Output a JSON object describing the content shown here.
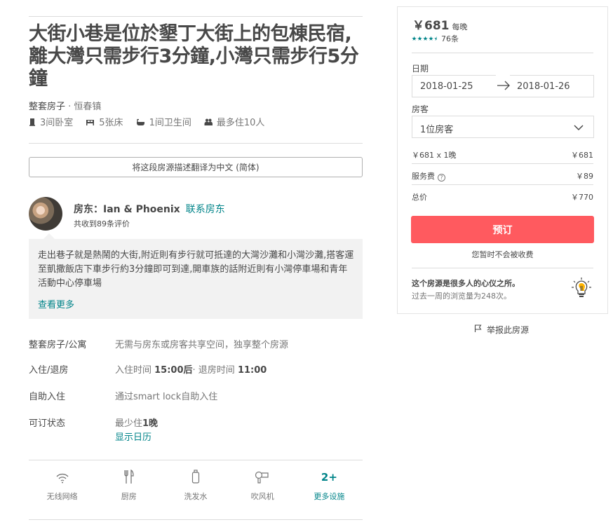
{
  "listing": {
    "title": "大街小巷是位於墾丁大街上的包棟民宿,離大灣只需步行3分鐘,小灣只需步行5分鐘",
    "type": "整套房子",
    "separator": " · ",
    "location": "恒春镇",
    "specs": [
      {
        "icon": "bedroom-icon",
        "label": "3间卧室"
      },
      {
        "icon": "bed-icon",
        "label": "5张床"
      },
      {
        "icon": "bathroom-icon",
        "label": "1间卫生间"
      },
      {
        "icon": "guests-icon",
        "label": "最多住10人"
      }
    ],
    "translate_label": "将这段房源描述翻译为中文 (简体)"
  },
  "host": {
    "prefix": "房东：",
    "name": "Ian & Phoenix",
    "contact_label": "联系房东",
    "reviews": "共收到89条评价"
  },
  "description": {
    "text": "走出巷子就是熱鬧的大街,附近則有步行就可抵達的大灣沙灘和小灣沙灘,搭客運至凱撒飯店下車步行約3分鐘即可到達,開車族的話附近則有小灣停車場和青年活動中心停車場",
    "read_more": "查看更多"
  },
  "details": {
    "space": {
      "label": "整套房子/公寓",
      "value": "无需与房东或房客共享空间，独享整个房源"
    },
    "checkin": {
      "label": "入住/退房",
      "in_prefix": "入住时间 ",
      "in_time": "15:00后",
      "out_prefix": "· 退房时间 ",
      "out_time": "11:00"
    },
    "self_checkin": {
      "label": "自助入住",
      "value": "通过smart lock自助入住"
    },
    "availability": {
      "label": "可订状态",
      "min_prefix": "最少住",
      "min_value": "1晚",
      "calendar_link": "显示日历"
    }
  },
  "amenities": [
    {
      "icon": "wifi-icon",
      "label": "无线网络"
    },
    {
      "icon": "kitchen-icon",
      "label": "厨房"
    },
    {
      "icon": "shampoo-icon",
      "label": "洗发水"
    },
    {
      "icon": "hairdryer-icon",
      "label": "吹风机"
    }
  ],
  "amenities_more": {
    "count": "2+",
    "label": "更多设施"
  },
  "booking": {
    "price": "￥681",
    "per_night": "每晚",
    "rating": 4.5,
    "review_count": "76条",
    "date_label": "日期",
    "checkin_date": "2018-01-25",
    "checkout_date": "2018-01-26",
    "guests_label": "房客",
    "guests_value": "1位房客",
    "line_nights_label": "￥681 x 1晚",
    "line_nights_value": "￥681",
    "service_fee_label": "服务费",
    "service_fee_value": "￥89",
    "total_label": "总价",
    "total_value": "￥770",
    "book_label": "预订",
    "no_charge": "您暂时不会被收费",
    "popular_title": "这个房源是很多人的心仪之所。",
    "popular_sub": "过去一周的浏览量为248次。"
  },
  "report_label": "举报此房源",
  "colors": {
    "accent": "#008489",
    "book": "#ff5a5f",
    "text": "#484848",
    "muted": "#767676"
  }
}
